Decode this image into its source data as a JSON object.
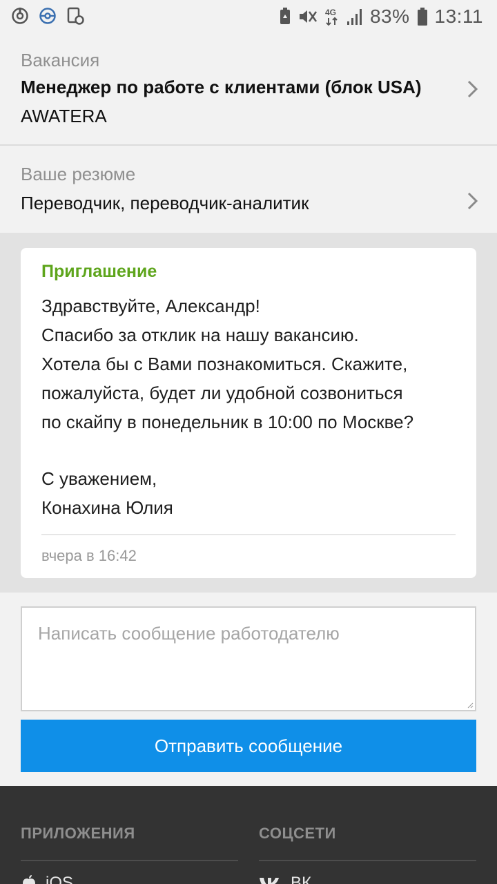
{
  "status_bar": {
    "icons_left": [
      "sync-icon",
      "pokeball-icon",
      "screenshot-icon"
    ],
    "icons_right": [
      "battery-saver-icon",
      "mute-icon",
      "network-4g-icon",
      "signal-icon",
      "battery-icon"
    ],
    "network": "4G",
    "battery": "83%",
    "time": "13:11"
  },
  "vacancy": {
    "label": "Вакансия",
    "title": "Менеджер по работе с клиентами (блок USA)",
    "company": "AWATERA"
  },
  "resume": {
    "label": "Ваше резюме",
    "title": "Переводчик, переводчик-аналитик"
  },
  "message": {
    "kind": "Приглашение",
    "lines": [
      "Здравствуйте, Александр!",
      "Спасибо за отклик на нашу вакансию.",
      "Хотела бы с Вами познакомиться. Скажите,",
      "пожалуйста, будет ли удобной созвониться",
      "по скайпу в понедельник в 10:00 по Москве?",
      "",
      "С уважением,",
      "Конахина Юлия"
    ],
    "time": "вчера в 16:42",
    "kind_color": "#5ea51c"
  },
  "compose": {
    "placeholder": "Написать сообщение работодателю",
    "send_label": "Отправить сообщение",
    "button_color": "#0f8fe8"
  },
  "footer": {
    "apps_heading": "ПРИЛОЖЕНИЯ",
    "apps_item": "iOS",
    "social_heading": "СОЦСЕТИ",
    "social_item": "ВК"
  }
}
